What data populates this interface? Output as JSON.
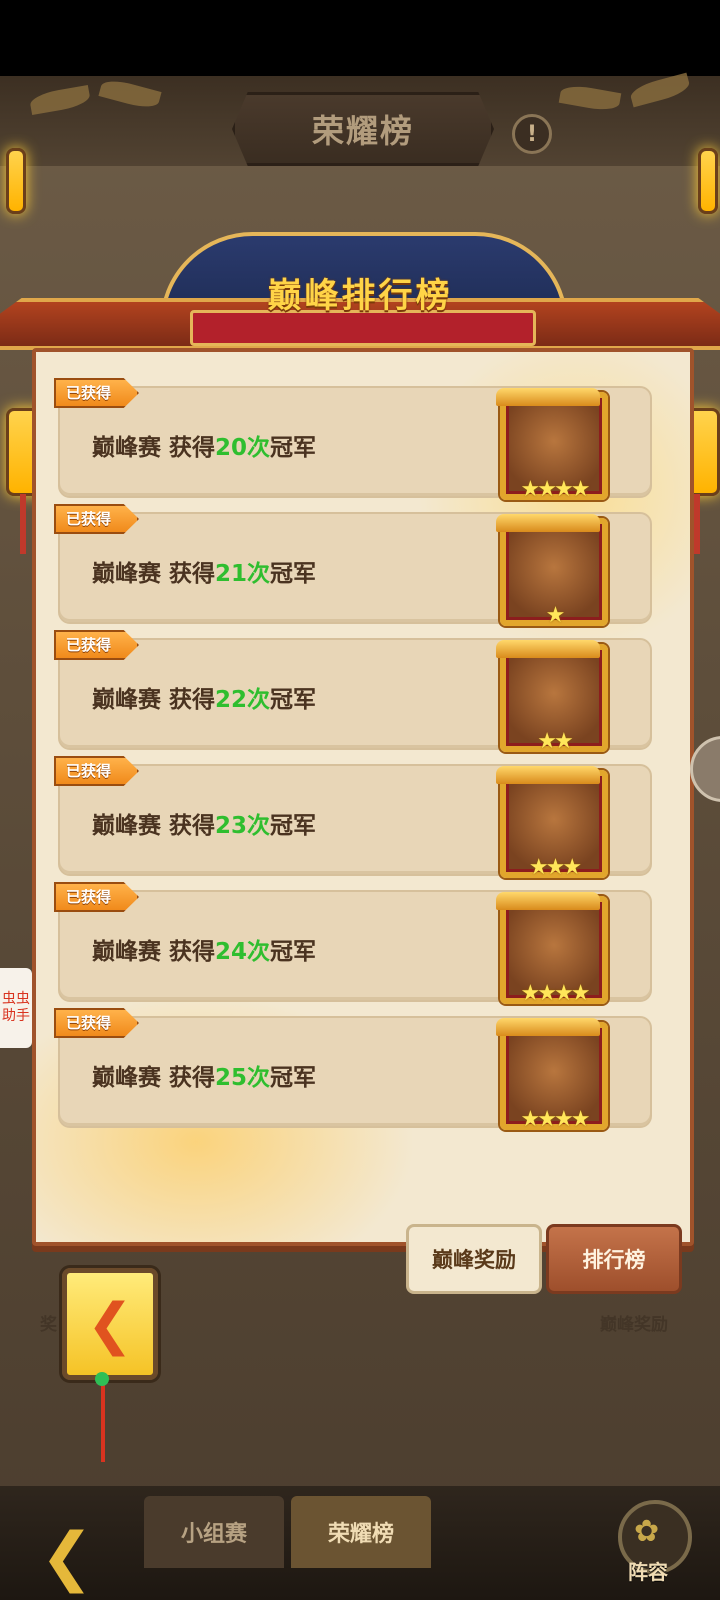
{
  "header": {
    "title": "荣耀榜",
    "info_icon": "exclamation-icon"
  },
  "board": {
    "title": "巅峰排行榜"
  },
  "achievements": [
    {
      "badge": "已获得",
      "prefix": "巅峰赛 获得",
      "count": "20次",
      "suffix": "冠军",
      "stars": "★★★★"
    },
    {
      "badge": "已获得",
      "prefix": "巅峰赛 获得",
      "count": "21次",
      "suffix": "冠军",
      "stars": "★"
    },
    {
      "badge": "已获得",
      "prefix": "巅峰赛 获得",
      "count": "22次",
      "suffix": "冠军",
      "stars": "★★"
    },
    {
      "badge": "已获得",
      "prefix": "巅峰赛 获得",
      "count": "23次",
      "suffix": "冠军",
      "stars": "★★★"
    },
    {
      "badge": "已获得",
      "prefix": "巅峰赛 获得",
      "count": "24次",
      "suffix": "冠军",
      "stars": "★★★★"
    },
    {
      "badge": "已获得",
      "prefix": "巅峰赛 获得",
      "count": "25次",
      "suffix": "冠军",
      "stars": "★★★★"
    }
  ],
  "tabs": {
    "rewards": "巅峰奖励",
    "ranking": "排行榜"
  },
  "background_labels": {
    "left": "奖",
    "right": "巅峰奖励"
  },
  "side_helper": "虫虫助手",
  "bottom_nav": {
    "group_stage": "小组赛",
    "honor_board": "荣耀榜",
    "lineup": "阵容"
  },
  "colors": {
    "highlight_green": "#2fbe2f",
    "accent_gold": "#ffd447",
    "panel_bg": "#f3e8d0"
  }
}
